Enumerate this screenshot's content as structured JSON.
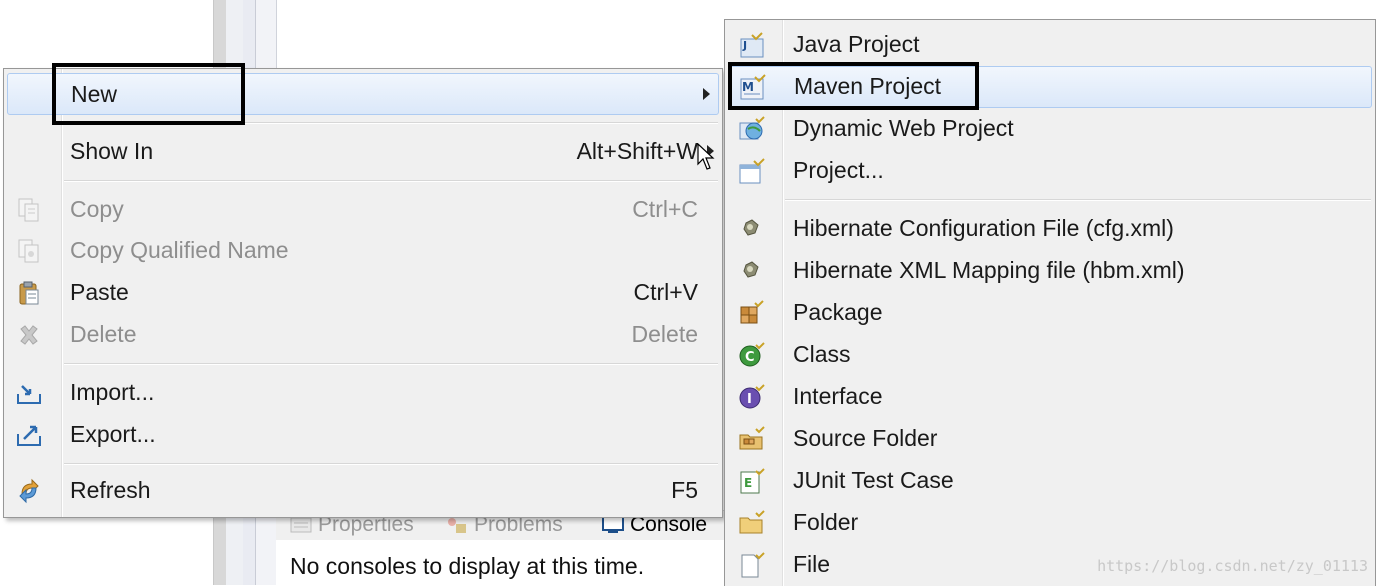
{
  "background": {
    "console_tabs": [
      {
        "label": "Properties",
        "icon": "properties-icon",
        "active": false
      },
      {
        "label": "Problems",
        "icon": "problems-icon",
        "active": false
      },
      {
        "label": "Console",
        "icon": "console-icon",
        "active": true
      }
    ],
    "console_message": "No consoles to display at this time."
  },
  "context_menu": {
    "items": [
      {
        "label": "New",
        "accelerator": "",
        "icon": "",
        "has_submenu": true,
        "enabled": true,
        "highlighted": true
      },
      {
        "label": "Show In",
        "accelerator": "Alt+Shift+W",
        "icon": "",
        "has_submenu": true,
        "enabled": true
      },
      {
        "label": "Copy",
        "accelerator": "Ctrl+C",
        "icon": "copy-icon",
        "enabled": false
      },
      {
        "label": "Copy Qualified Name",
        "accelerator": "",
        "icon": "copy-qualified-name-icon",
        "enabled": false
      },
      {
        "label": "Paste",
        "accelerator": "Ctrl+V",
        "icon": "paste-icon",
        "enabled": true
      },
      {
        "label": "Delete",
        "accelerator": "Delete",
        "icon": "delete-icon",
        "enabled": false
      },
      {
        "label": "Import...",
        "accelerator": "",
        "icon": "import-icon",
        "enabled": true
      },
      {
        "label": "Export...",
        "accelerator": "",
        "icon": "export-icon",
        "enabled": true
      },
      {
        "label": "Refresh",
        "accelerator": "F5",
        "icon": "refresh-icon",
        "enabled": true
      }
    ]
  },
  "submenu": {
    "items": [
      {
        "label": "Java Project",
        "icon": "java-project-icon"
      },
      {
        "label": "Maven Project",
        "icon": "maven-project-icon",
        "highlighted": true
      },
      {
        "label": "Dynamic Web Project",
        "icon": "dynamic-web-project-icon"
      },
      {
        "label": "Project...",
        "icon": "project-icon"
      },
      {
        "label": "Hibernate Configuration File (cfg.xml)",
        "icon": "hibernate-icon"
      },
      {
        "label": "Hibernate XML Mapping file (hbm.xml)",
        "icon": "hibernate-icon"
      },
      {
        "label": "Package",
        "icon": "package-icon"
      },
      {
        "label": "Class",
        "icon": "class-icon"
      },
      {
        "label": "Interface",
        "icon": "interface-icon"
      },
      {
        "label": "Source Folder",
        "icon": "source-folder-icon"
      },
      {
        "label": "JUnit Test Case",
        "icon": "junit-test-case-icon"
      },
      {
        "label": "Folder",
        "icon": "folder-icon"
      },
      {
        "label": "File",
        "icon": "file-icon"
      }
    ]
  },
  "watermark": "https://blog.csdn.net/zy_01113",
  "colors": {
    "menu_bg": "#f0f0f0",
    "highlight_bg": "#dbe8f9",
    "highlight_border": "#aecbf1",
    "annotation_box": "#000000",
    "disabled_text": "#8e8e8e"
  }
}
